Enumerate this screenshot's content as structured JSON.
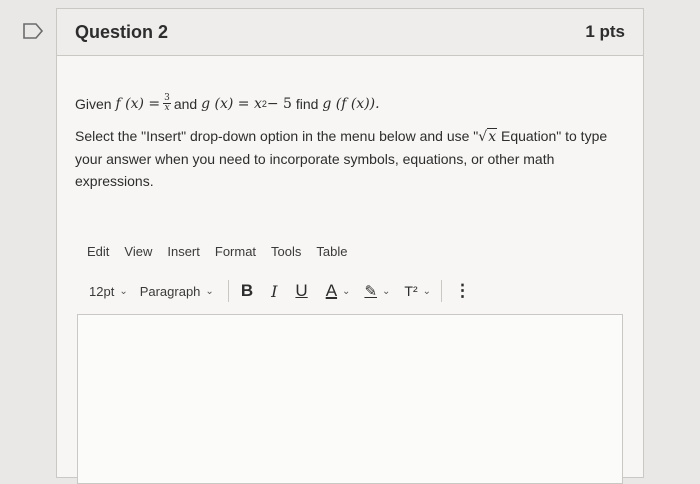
{
  "question": {
    "title": "Question 2",
    "points": "1 pts"
  },
  "prompt": {
    "given_word": "Given",
    "f_expr": "f (x) =",
    "frac_num": "3",
    "frac_den": "x",
    "and_word": "and",
    "g_expr": "g (x) = x",
    "exp": "2",
    "minus_part": " − 5",
    "find_word": "find",
    "target": "g (f (x))."
  },
  "instructions": {
    "part1": "Select the \"Insert\" drop-down option in the menu below and use \"",
    "sqrt_arg": "x",
    "part2": " Equation\" to type your answer when you need to incorporate symbols, equations, or other math expressions."
  },
  "menubar": [
    "Edit",
    "View",
    "Insert",
    "Format",
    "Tools",
    "Table"
  ],
  "toolbar": {
    "font_size": "12pt",
    "block_format": "Paragraph",
    "bold": "B",
    "italic": "I",
    "underline": "U",
    "text_color": "A",
    "highlight": "✎",
    "superscript": "T²",
    "more": "⋮"
  }
}
